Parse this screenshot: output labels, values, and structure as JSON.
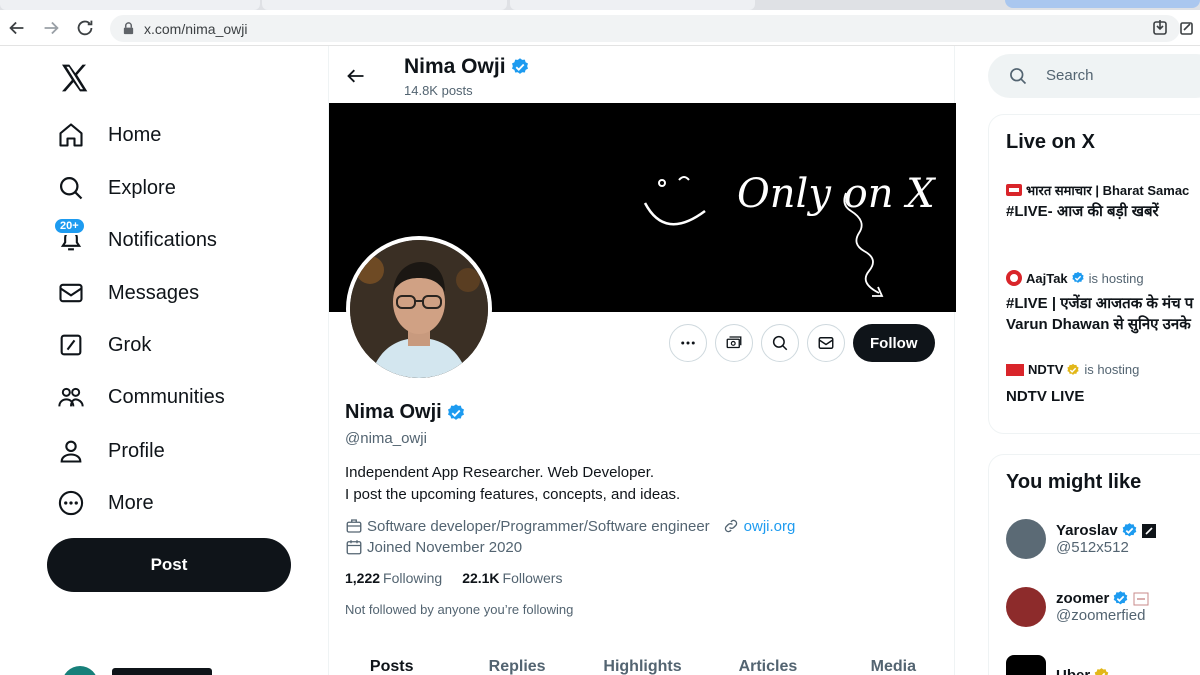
{
  "browser": {
    "url": "x.com/nima_owji"
  },
  "nav": {
    "items": [
      {
        "label": "Home",
        "icon": "home-icon"
      },
      {
        "label": "Explore",
        "icon": "search-icon"
      },
      {
        "label": "Notifications",
        "icon": "bell-icon",
        "badge": "20+"
      },
      {
        "label": "Messages",
        "icon": "envelope-icon"
      },
      {
        "label": "Grok",
        "icon": "grok-icon"
      },
      {
        "label": "Communities",
        "icon": "people-icon"
      },
      {
        "label": "Profile",
        "icon": "person-icon"
      },
      {
        "label": "More",
        "icon": "more-circle-icon"
      }
    ],
    "post_label": "Post"
  },
  "header": {
    "name": "Nima Owji",
    "posts": "14.8K posts"
  },
  "banner": {
    "text": "Only on X"
  },
  "profile": {
    "name": "Nima Owji",
    "handle": "@nima_owji",
    "bio_line1": "Independent App Researcher. Web Developer.",
    "bio_line2": "I post the upcoming features, concepts, and ideas.",
    "category": "Software developer/Programmer/Software engineer",
    "link": "owji.org",
    "joined": "Joined November 2020",
    "following_count": "1,222",
    "following_label": "Following",
    "followers_count": "22.1K",
    "followers_label": "Followers",
    "not_followed": "Not followed by anyone you’re following",
    "follow_label": "Follow"
  },
  "tabs": [
    "Posts",
    "Replies",
    "Highlights",
    "Articles",
    "Media"
  ],
  "search": {
    "placeholder": "Search"
  },
  "live": {
    "title": "Live on X",
    "items": [
      {
        "host": "भारत समाचार | Bharat Samac",
        "suffix": "",
        "title": "#LIVE- आज की बड़ी खबरें"
      },
      {
        "host": "AajTak",
        "suffix": "is hosting",
        "title": "#LIVE | एजेंडा आजतक के मंच प",
        "title2": "Varun Dhawan से सुनिए उनके"
      },
      {
        "host": "NDTV",
        "suffix": "is hosting",
        "title": "NDTV LIVE"
      }
    ]
  },
  "suggest": {
    "title": "You might like",
    "items": [
      {
        "name": "Yaroslav",
        "handle": "@512x512"
      },
      {
        "name": "zoomer",
        "handle": "@zoomerfied"
      },
      {
        "name": "Uber",
        "handle": ""
      }
    ]
  },
  "colors": {
    "accent": "#1d9bf0",
    "dark": "#0f1419",
    "muted": "#536471"
  }
}
